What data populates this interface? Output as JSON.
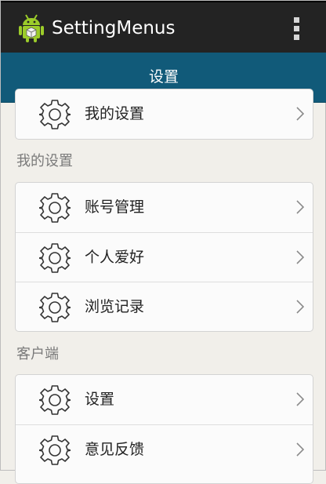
{
  "app": {
    "title": "SettingMenus",
    "icon": "android-robot-icon",
    "overflow_icon": "overflow-menu-icon"
  },
  "title_bar": {
    "title": "设置"
  },
  "top_card": {
    "items": [
      {
        "label": "我的设置",
        "icon": "gear-icon"
      }
    ]
  },
  "sections": [
    {
      "header": "我的设置",
      "items": [
        {
          "label": "账号管理",
          "icon": "gear-icon"
        },
        {
          "label": "个人爱好",
          "icon": "gear-icon"
        },
        {
          "label": "浏览记录",
          "icon": "gear-icon"
        }
      ]
    },
    {
      "header": "客户端",
      "items": [
        {
          "label": "设置",
          "icon": "gear-icon"
        },
        {
          "label": "意见反馈",
          "icon": "gear-icon"
        }
      ]
    }
  ],
  "colors": {
    "action_bar": "#232323",
    "title_bar": "#115a79",
    "background": "#f1efea",
    "card": "#fbfbfb"
  }
}
